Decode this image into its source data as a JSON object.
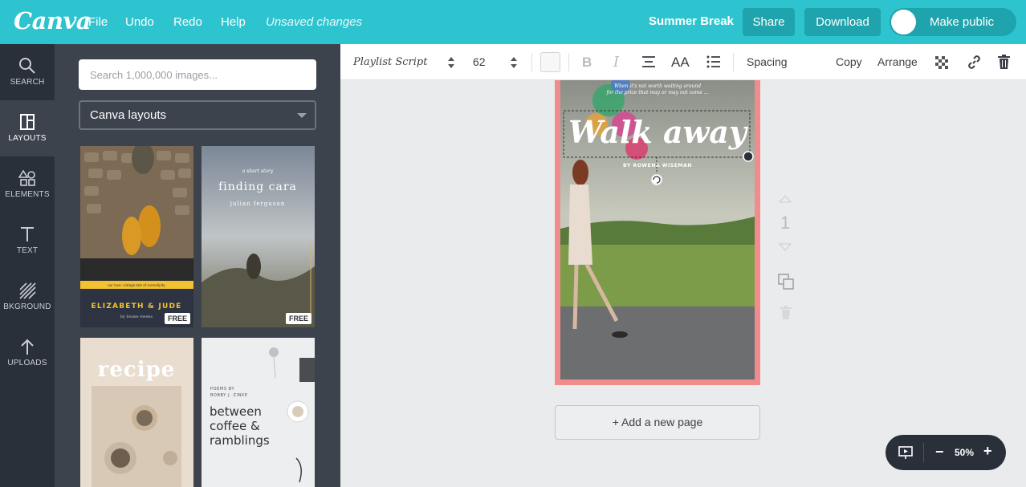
{
  "app": {
    "logo": "Canva",
    "menu": {
      "file": "File",
      "undo": "Undo",
      "redo": "Redo",
      "help": "Help",
      "status": "Unsaved changes"
    },
    "design_title": "Summer Break",
    "buttons": {
      "share": "Share",
      "download": "Download",
      "make_public": "Make public"
    },
    "make_public_enabled": false
  },
  "rail": [
    {
      "label": "SEARCH",
      "icon": "search-icon"
    },
    {
      "label": "LAYOUTS",
      "icon": "layouts-icon",
      "active": true
    },
    {
      "label": "ELEMENTS",
      "icon": "elements-icon"
    },
    {
      "label": "TEXT",
      "icon": "text-icon"
    },
    {
      "label": "BKGROUND",
      "icon": "background-icon"
    },
    {
      "label": "UPLOADS",
      "icon": "uploads-icon"
    }
  ],
  "panel": {
    "search_placeholder": "Search 1,000,000 images...",
    "dropdown_value": "Canva layouts",
    "layouts": [
      {
        "caption": "our love: vintage tale of serendipity",
        "title": "ELIZABETH & JUDE",
        "byline": "by louise owens",
        "badge": "FREE"
      },
      {
        "kicker": "a short story",
        "title": "finding cara",
        "byline": "julian ferguson",
        "badge": "FREE"
      },
      {
        "title": "recipe"
      },
      {
        "kicker_1": "POEMS BY",
        "kicker_2": "BOBBY J. ZINKE",
        "title_1": "between",
        "title_2": "coffee &",
        "title_3": "ramblings"
      }
    ]
  },
  "toolbar": {
    "font": "Playlist Script",
    "size": "62",
    "spacing": "Spacing",
    "copy": "Copy",
    "arrange": "Arrange"
  },
  "canvas": {
    "tagline_1": "When it's not worth waiting around",
    "tagline_2": "for the price that may or may not come ...",
    "title": "Walk away",
    "byline": "BY ROWENA WISEMAN",
    "page_number": "1",
    "add_page": "+ Add a new page",
    "zoom": "50%"
  },
  "colors": {
    "brand": "#2ec4cf",
    "brand_dark": "#1fa3ad",
    "rail": "#293039",
    "panel": "#3c434d",
    "page_border": "#f08c8c"
  }
}
